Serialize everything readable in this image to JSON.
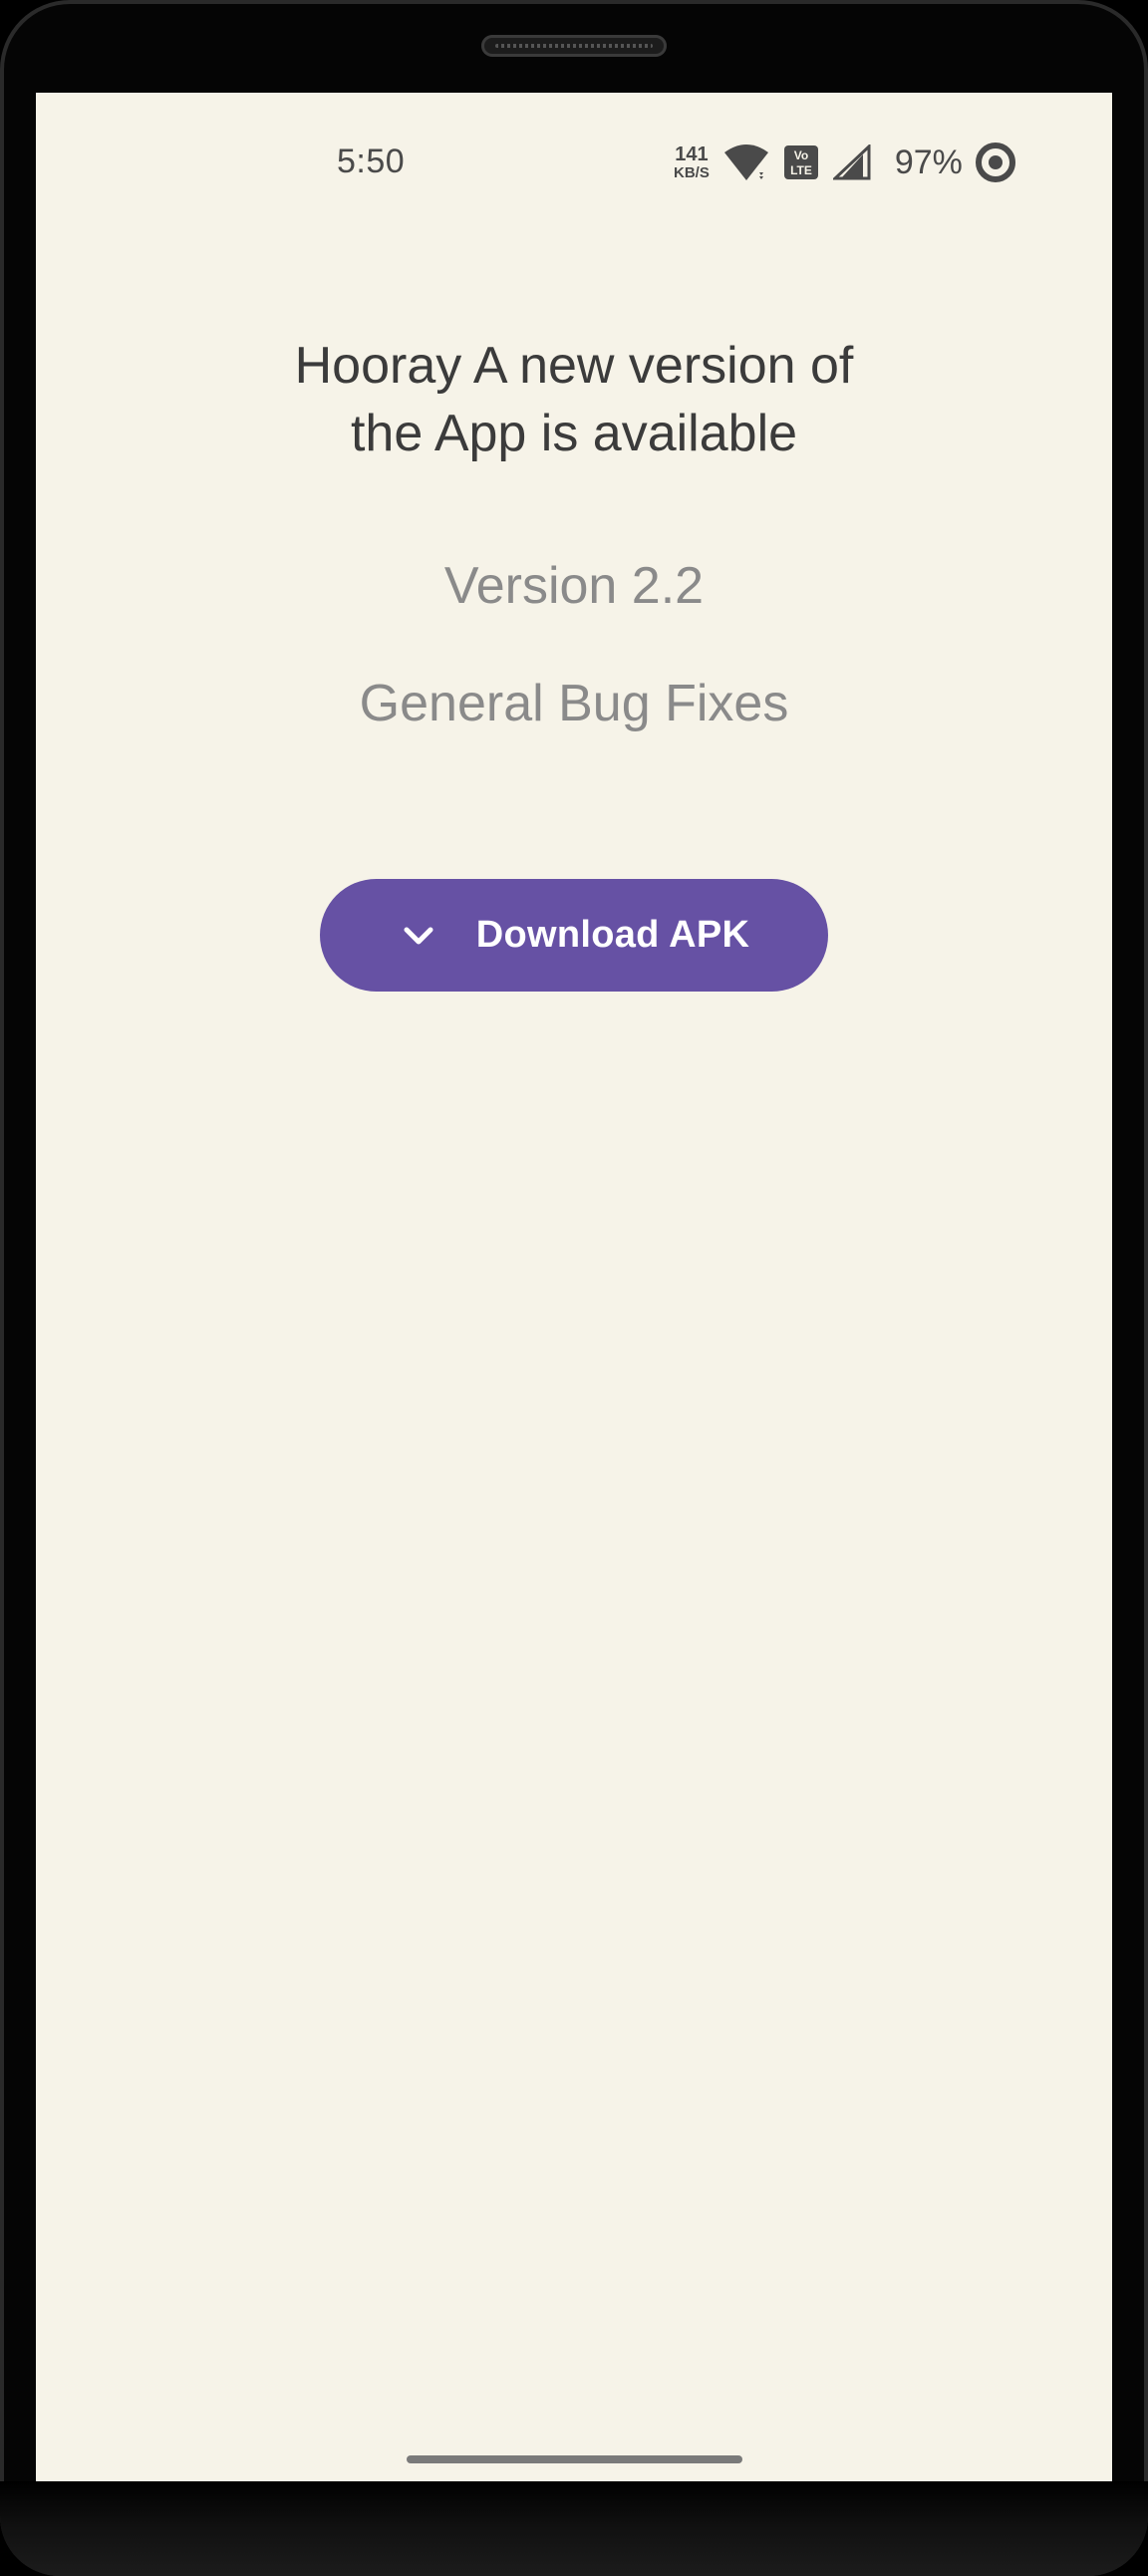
{
  "status_bar": {
    "time": "5:50",
    "net_speed_value": "141",
    "net_speed_unit": "KB/S",
    "battery_percent": "97%",
    "icons": [
      "wifi-icon",
      "volte-icon",
      "cell-signal-icon",
      "battery-saver-icon"
    ]
  },
  "update": {
    "headline": "Hooray A new version of the App is available",
    "version": "Version 2.2",
    "notes": "General Bug Fixes",
    "download_label": "Download APK",
    "download_icon": "chevron-down-icon"
  },
  "colors": {
    "background": "#f6f3e8",
    "button": "#6651a4",
    "headline_text": "#3b3b3b",
    "secondary_text": "#8a8a8a"
  }
}
